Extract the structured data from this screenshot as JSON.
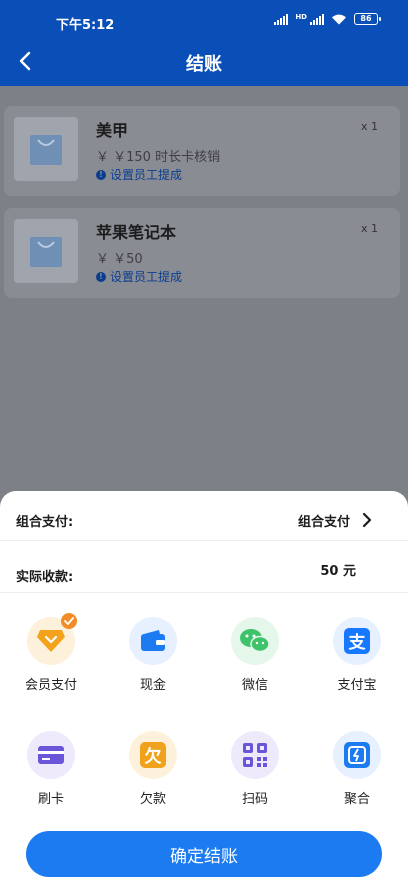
{
  "status_bar": {
    "time": "下午5:12",
    "battery": "86"
  },
  "header": {
    "title": "结账"
  },
  "order_items": [
    {
      "name": "美甲",
      "price": "￥ ￥150 时长卡核销",
      "staff_link": "设置员工提成",
      "qty": "x 1"
    },
    {
      "name": "苹果笔记本",
      "price": "￥ ￥50",
      "staff_link": "设置员工提成",
      "qty": "x 1"
    }
  ],
  "payment": {
    "combo_label": "组合支付:",
    "combo_value": "组合支付",
    "actual_label": "实际收款:",
    "actual_value": "50 元"
  },
  "methods": [
    {
      "label": "会员支付",
      "icon": "member-pay-icon",
      "selected": true
    },
    {
      "label": "现金",
      "icon": "wallet-icon",
      "selected": false
    },
    {
      "label": "微信",
      "icon": "wechat-icon",
      "selected": false
    },
    {
      "label": "支付宝",
      "icon": "alipay-icon",
      "selected": false
    },
    {
      "label": "刷卡",
      "icon": "card-icon",
      "selected": false
    },
    {
      "label": "欠款",
      "icon": "debt-icon",
      "selected": false
    },
    {
      "label": "扫码",
      "icon": "qr-code-icon",
      "selected": false
    },
    {
      "label": "聚合",
      "icon": "aggregate-pay-icon",
      "selected": false
    }
  ],
  "confirm_label": "确定结账",
  "colors": {
    "header": "#0a4fb8",
    "primary_button": "#1c7bf0",
    "member_pay": "#f3a21c",
    "wallet": "#1c7bf0",
    "wechat": "#3ec36b",
    "alipay": "#1677ff",
    "card": "#6b55d9",
    "debt": "#f0a21c",
    "qr": "#6b55d9",
    "aggregate": "#1c7bf0"
  }
}
